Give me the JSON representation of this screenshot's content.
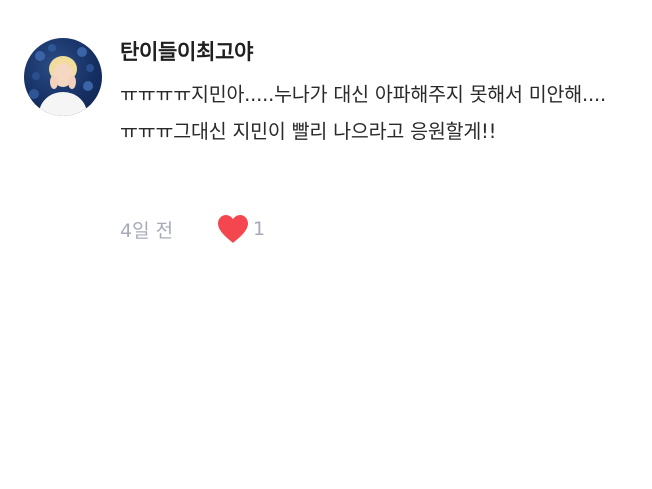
{
  "comment": {
    "username": "탄이들이최고야",
    "body": "ㅠㅠㅠㅠ지민아.....누나가 대신 아파해주지 못해서 미안해....ㅠㅠㅠ그대신 지민이 빨리 나으라고 응원할게!!",
    "timestamp": "4일 전",
    "like_count": "1"
  },
  "icons": {
    "like": "heart-icon",
    "avatar": "avatar-photo"
  },
  "colors": {
    "heart": "#f4464f",
    "meta_text": "#a7abb8",
    "username": "#1f1f1f",
    "body": "#2a2a2a"
  }
}
